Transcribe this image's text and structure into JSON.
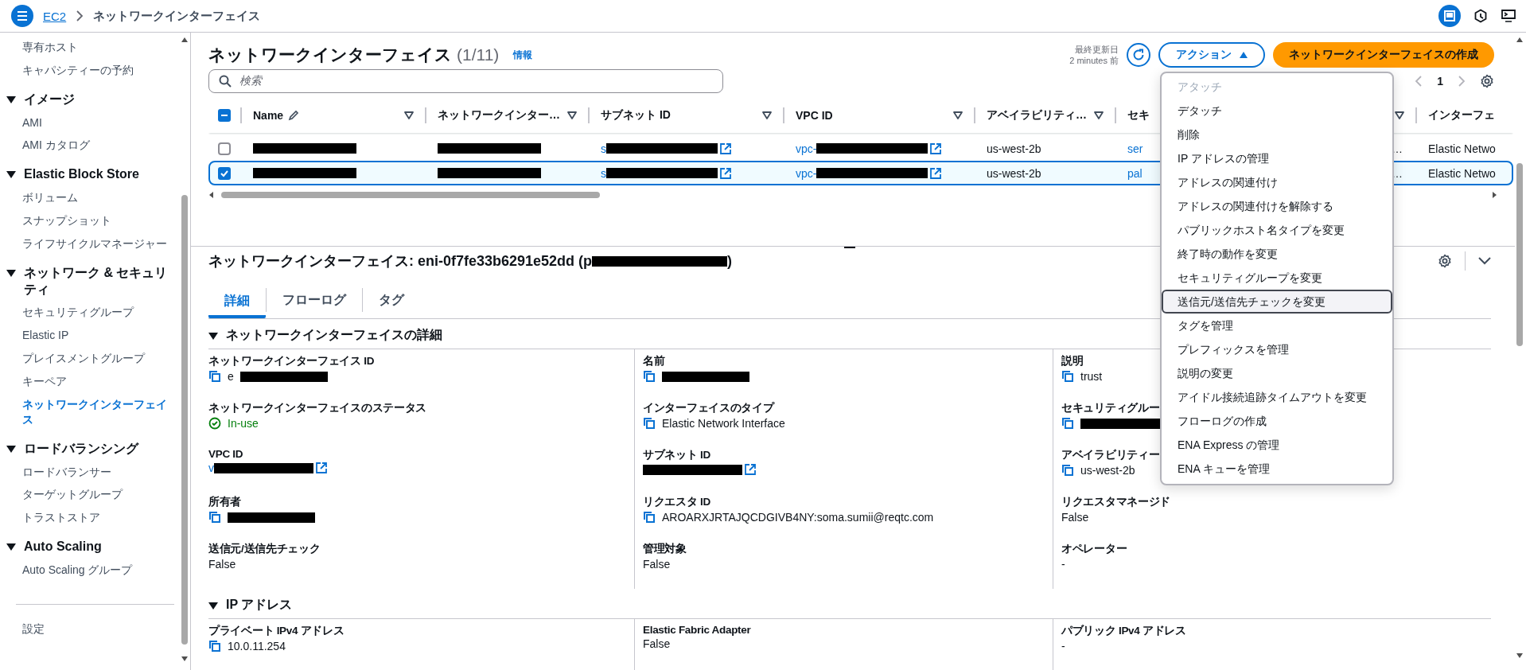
{
  "breadcrumb": {
    "service": "EC2",
    "page": "ネットワークインターフェイス"
  },
  "sidebar": {
    "items": [
      {
        "kind": "link",
        "label": "専有ホスト",
        "selected": false
      },
      {
        "kind": "link",
        "label": "キャパシティーの予約",
        "selected": false
      },
      {
        "kind": "group",
        "label": "イメージ",
        "expanded": true
      },
      {
        "kind": "link",
        "label": "AMI",
        "selected": false
      },
      {
        "kind": "link",
        "label": "AMI カタログ",
        "selected": false
      },
      {
        "kind": "group",
        "label": "Elastic Block Store",
        "expanded": true
      },
      {
        "kind": "link",
        "label": "ボリューム",
        "selected": false
      },
      {
        "kind": "link",
        "label": "スナップショット",
        "selected": false
      },
      {
        "kind": "link",
        "label": "ライフサイクルマネージャー",
        "selected": false
      },
      {
        "kind": "group",
        "label": "ネットワーク & セキュリティ",
        "expanded": true
      },
      {
        "kind": "link",
        "label": "セキュリティグループ",
        "selected": false
      },
      {
        "kind": "link",
        "label": "Elastic IP",
        "selected": false
      },
      {
        "kind": "link",
        "label": "プレイスメントグループ",
        "selected": false
      },
      {
        "kind": "link",
        "label": "キーペア",
        "selected": false
      },
      {
        "kind": "link",
        "label": "ネットワークインターフェイス",
        "selected": true
      },
      {
        "kind": "group",
        "label": "ロードバランシング",
        "expanded": true
      },
      {
        "kind": "link",
        "label": "ロードバランサー",
        "selected": false
      },
      {
        "kind": "link",
        "label": "ターゲットグループ",
        "selected": false
      },
      {
        "kind": "link",
        "label": "トラストストア",
        "selected": false
      },
      {
        "kind": "group",
        "label": "Auto Scaling",
        "expanded": true
      },
      {
        "kind": "link",
        "label": "Auto Scaling グループ",
        "selected": false
      }
    ],
    "footer": "設定"
  },
  "list_panel": {
    "title": "ネットワークインターフェイス",
    "count": "(1/11)",
    "info": "情報",
    "updated_label": "最終更新日",
    "updated_value": "2 minutes 前",
    "actions_button": "アクション",
    "actions_expanded": true,
    "create_button": "ネットワークインターフェイスの作成",
    "search": {
      "placeholder": "検索"
    },
    "page": "1",
    "header_checkbox": {
      "checked": true,
      "indeterminate": true
    },
    "columns": [
      {
        "kind": "editable",
        "label": "Name"
      },
      {
        "kind": "plain",
        "label": "ネットワークインター…"
      },
      {
        "kind": "plain",
        "label": "サブネット ID"
      },
      {
        "kind": "plain",
        "label": "VPC ID"
      },
      {
        "kind": "plain",
        "label": "アベイラビリティ…"
      },
      {
        "kind": "cut",
        "label": "セキ"
      },
      {
        "kind": "covered"
      },
      {
        "kind": "cut",
        "label": "インターフェ"
      }
    ],
    "rows": [
      {
        "selected": false,
        "cells": [
          {
            "kind": "redacted"
          },
          {
            "kind": "redacted"
          },
          {
            "kind": "link_redacted",
            "text": "s"
          },
          {
            "kind": "link_redacted",
            "text": "vpc-"
          },
          {
            "kind": "text",
            "text": "us-west-2b"
          },
          {
            "kind": "link",
            "text": "ser"
          },
          {
            "kind": "text_end",
            "text": "…"
          },
          {
            "kind": "text",
            "text": "Elastic Netwo"
          }
        ]
      },
      {
        "selected": true,
        "cells": [
          {
            "kind": "redacted"
          },
          {
            "kind": "redacted"
          },
          {
            "kind": "link_redacted",
            "text": "s"
          },
          {
            "kind": "link_redacted",
            "text": "vpc-"
          },
          {
            "kind": "text",
            "text": "us-west-2b"
          },
          {
            "kind": "link",
            "text": "pal"
          },
          {
            "kind": "text_end",
            "text": "…"
          },
          {
            "kind": "text",
            "text": "Elastic Netwo"
          }
        ]
      }
    ]
  },
  "actions_menu": [
    {
      "label": "アタッチ",
      "disabled": true,
      "focused": false
    },
    {
      "label": "デタッチ",
      "disabled": false,
      "focused": false
    },
    {
      "label": "削除",
      "disabled": false,
      "focused": false
    },
    {
      "label": "IP アドレスの管理",
      "disabled": false,
      "focused": false
    },
    {
      "label": "アドレスの関連付け",
      "disabled": false,
      "focused": false
    },
    {
      "label": "アドレスの関連付けを解除する",
      "disabled": false,
      "focused": false
    },
    {
      "label": "パブリックホスト名タイプを変更",
      "disabled": false,
      "focused": false
    },
    {
      "label": "終了時の動作を変更",
      "disabled": false,
      "focused": false
    },
    {
      "label": "セキュリティグループを変更",
      "disabled": false,
      "focused": false
    },
    {
      "label": "送信元/送信先チェックを変更",
      "disabled": false,
      "focused": true
    },
    {
      "label": "タグを管理",
      "disabled": false,
      "focused": false
    },
    {
      "label": "プレフィックスを管理",
      "disabled": false,
      "focused": false
    },
    {
      "label": "説明の変更",
      "disabled": false,
      "focused": false
    },
    {
      "label": "アイドル接続追跡タイムアウトを変更",
      "disabled": false,
      "focused": false
    },
    {
      "label": "フローログの作成",
      "disabled": false,
      "focused": false
    },
    {
      "label": "ENA Express の管理",
      "disabled": false,
      "focused": false
    },
    {
      "label": "ENA キューを管理",
      "disabled": false,
      "focused": false
    }
  ],
  "details": {
    "title": "ネットワークインターフェイス: eni-0f7fe33b6291e52dd (p",
    "title_redacted": true,
    "title_end": ")",
    "tabs": [
      {
        "label": "詳細",
        "selected": true
      },
      {
        "label": "フローログ",
        "selected": false
      },
      {
        "label": "タグ",
        "selected": false
      }
    ],
    "sections": [
      {
        "title": "ネットワークインターフェイスの詳細",
        "expanded": true,
        "columns": [
          [
            {
              "label": "ネットワークインターフェイス ID",
              "kind": "copy_redacted",
              "value": "e"
            },
            {
              "label": "ネットワークインターフェイスのステータス",
              "kind": "status",
              "value": "In-use"
            },
            {
              "label": "VPC ID",
              "kind": "link_redacted",
              "value": "v"
            },
            {
              "label": "所有者",
              "kind": "copy_redacted"
            },
            {
              "label": "送信元/送信先チェック",
              "kind": "plain",
              "value": "False"
            }
          ],
          [
            {
              "label": "名前",
              "kind": "copy_redacted"
            },
            {
              "label": "インターフェイスのタイプ",
              "kind": "copy",
              "value": "Elastic Network Interface"
            },
            {
              "label": "サブネット ID",
              "kind": "link_redacted"
            },
            {
              "label": "リクエスタ ID",
              "kind": "copy",
              "value": "AROARXJRTAJQCDGIVB4NY:soma.sumii@reqtc.com"
            },
            {
              "label": "管理対象",
              "kind": "plain",
              "value": "False"
            }
          ],
          [
            {
              "label": "説明",
              "kind": "copy",
              "value": "trust"
            },
            {
              "label": "セキュリティグルー",
              "kind": "copy_redacted"
            },
            {
              "label": "アベイラビリティー",
              "kind": "copy",
              "value": "us-west-2b"
            },
            {
              "label": "リクエスタマネージド",
              "kind": "plain",
              "value": "False"
            },
            {
              "label": "オペレーター",
              "kind": "plain",
              "value": "-"
            }
          ]
        ]
      },
      {
        "title": "IP アドレス",
        "expanded": true,
        "columns": [
          [
            {
              "label": "プライベート IPv4 アドレス",
              "kind": "copy",
              "value": "10.0.11.254"
            }
          ],
          [
            {
              "label": "Elastic Fabric Adapter",
              "kind": "plain",
              "value": "False"
            }
          ],
          [
            {
              "label": "パブリック IPv4 アドレス",
              "kind": "plain",
              "value": "-"
            }
          ]
        ]
      }
    ]
  }
}
